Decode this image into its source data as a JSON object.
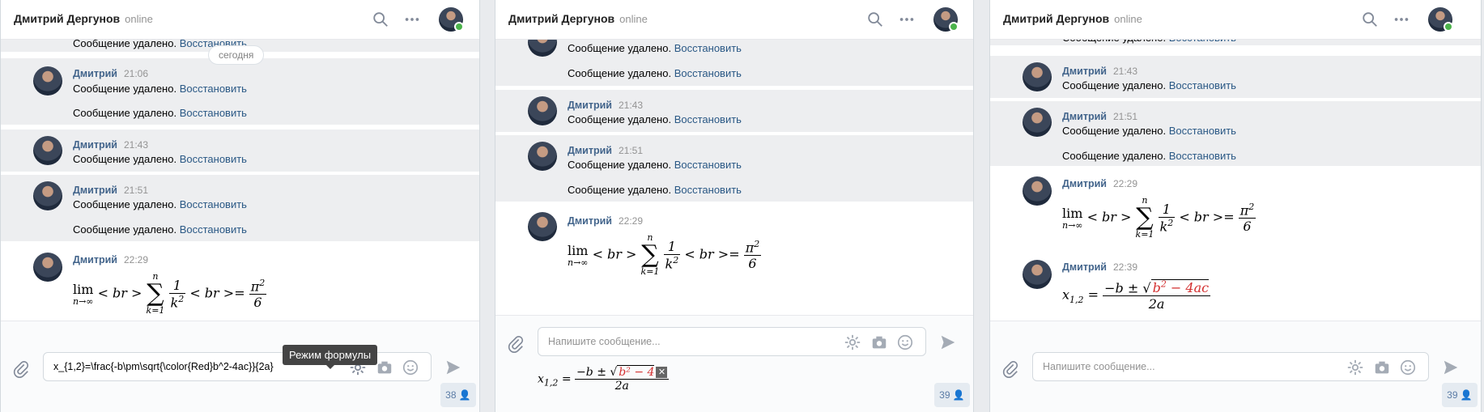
{
  "contact": {
    "name": "Дмитрий Дергунов",
    "status": "online"
  },
  "author_short": "Дмитрий",
  "deleted_text": "Сообщение удалено.",
  "restore_link": "Восстановить",
  "date_separator": "сегодня",
  "times": {
    "t2106": "21:06",
    "t2143": "21:43",
    "t2151": "21:51",
    "t2229": "22:29",
    "t2239": "22:39"
  },
  "formula_lim": {
    "lim": "lim",
    "lim_sub": "n→∞",
    "br_open": "< br >",
    "sum_top": "n",
    "sum": "∑",
    "sum_bottom": "k=1",
    "frac_num": "1",
    "frac_den_base": "k",
    "frac_den_exp": "2",
    "br_close": "< br >=",
    "rhs_num_base": "π",
    "rhs_num_exp": "2",
    "rhs_den": "6"
  },
  "formula_quad": {
    "lhs_base": "x",
    "lhs_sub": "1,2",
    "eq": "=",
    "num_prefix": "−b ±",
    "sqrt_sign": "√",
    "radicand_b": "b",
    "radicand_exp": "2",
    "radicand_rest": " − 4ac",
    "den": "2a",
    "preview_radicand_partial": "b² − 4",
    "close": "✕"
  },
  "composer": {
    "panel1_value": "x_{1,2}=\\frac{-b\\pm\\sqrt{\\color{Red}b^2-4ac}}{2a}",
    "placeholder": "Напишите сообщение...",
    "tooltip": "Режим формулы",
    "count_panel1": "38",
    "count_panel2": "39",
    "count_panel3": "39"
  },
  "icons": {
    "search": "search-icon",
    "more": "more-icon",
    "attach": "paperclip-icon",
    "gear": "gear-icon",
    "camera": "camera-icon",
    "smile": "smile-icon",
    "send": "send-icon",
    "user": "user-icon"
  },
  "colors": {
    "link": "#2a5885",
    "author": "#42648b",
    "deleted_bg": "#edeef0",
    "red": "#d32f2f"
  }
}
